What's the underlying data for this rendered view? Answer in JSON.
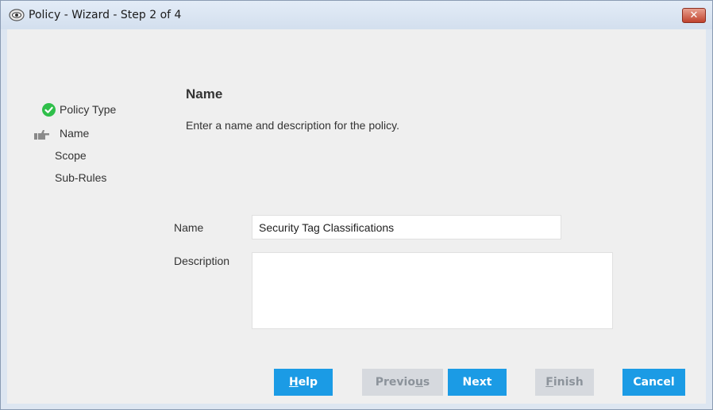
{
  "window": {
    "title": "Policy - Wizard - Step 2 of 4",
    "close_label": "✕"
  },
  "steps": [
    {
      "label": "Policy Type",
      "status": "complete",
      "icon": "check-circle-icon"
    },
    {
      "label": "Name",
      "status": "current",
      "icon": "pointing-hand-icon"
    },
    {
      "label": "Scope",
      "status": "pending"
    },
    {
      "label": "Sub-Rules",
      "status": "pending"
    }
  ],
  "main": {
    "heading": "Name",
    "instructions": "Enter a name and description for the policy."
  },
  "form": {
    "name_label": "Name",
    "name_value": "Security Tag Classifications",
    "description_label": "Description",
    "description_value": ""
  },
  "buttons": {
    "help": {
      "prefix": "",
      "mnemonic": "H",
      "suffix": "elp"
    },
    "previous": {
      "prefix": "Previo",
      "mnemonic": "u",
      "suffix": "s"
    },
    "next": "Next",
    "finish": {
      "prefix": "",
      "mnemonic": "F",
      "suffix": "inish"
    },
    "cancel": "Cancel"
  },
  "colors": {
    "accent": "#1b9be5",
    "check": "#2fbf4a",
    "disabled": "#d6d9de"
  }
}
